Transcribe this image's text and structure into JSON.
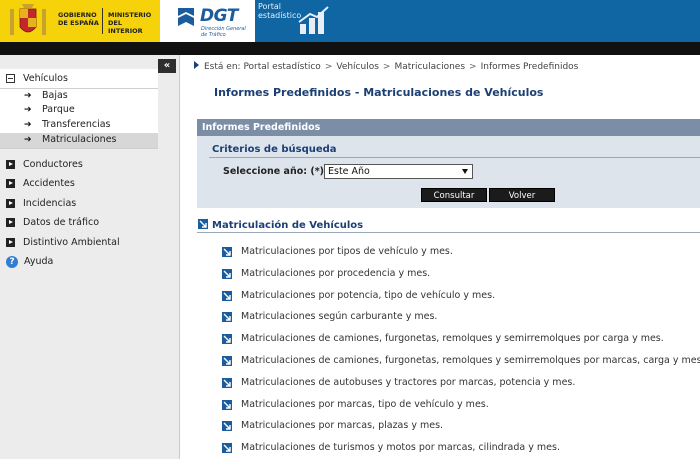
{
  "header": {
    "gov_line1": "GOBIERNO DE ESPAÑA",
    "gov_line2": "MINISTERIO DEL INTERIOR",
    "dgt_name": "DGT",
    "dgt_sub": "Dirección General de Tráfico",
    "portal_label": "Portal estadístico",
    "colors": {
      "gov": "#f5d20a",
      "bar": "#0f66a3",
      "strip": "#111111"
    }
  },
  "sidebar": {
    "collapse_symbol": "«",
    "groups": [
      {
        "label": "Vehículos",
        "open": true
      },
      {
        "label": "Conductores"
      },
      {
        "label": "Accidentes"
      },
      {
        "label": "Incidencias"
      },
      {
        "label": "Datos de tráfico"
      },
      {
        "label": "Distintivo Ambiental"
      }
    ],
    "vehiculos_items": [
      {
        "label": "Bajas"
      },
      {
        "label": "Parque"
      },
      {
        "label": "Transferencias"
      },
      {
        "label": "Matriculaciones",
        "active": true
      }
    ],
    "help_label": "Ayuda"
  },
  "breadcrumb": {
    "prefix": "Está en:",
    "items": [
      "Portal estadístico",
      "Vehículos",
      "Matriculaciones",
      "Informes Predefinidos"
    ],
    "separator": ">"
  },
  "page_title": "Informes Predefinidos - Matriculaciones de Vehículos",
  "panel": {
    "header": "Informes Predefinidos",
    "criteria_title": "Criterios de búsqueda",
    "year_label": "Seleccione año: (*)",
    "year_value": "Este Año",
    "consultar_label": "Consultar",
    "volver_label": "Volver"
  },
  "section_title": "Matriculación de Vehículos",
  "reports": [
    "Matriculaciones por tipos de vehículo y mes.",
    "Matriculaciones por procedencia y mes.",
    "Matriculaciones por potencia, tipo de vehículo y mes.",
    "Matriculaciones según carburante y mes.",
    "Matriculaciones de camiones, furgonetas, remolques y semirremolques por carga y mes.",
    "Matriculaciones de camiones, furgonetas, remolques y semirremolques por marcas, carga y mes.",
    "Matriculaciones de autobuses y tractores por marcas, potencia y mes.",
    "Matriculaciones por marcas, tipo de vehículo y mes.",
    "Matriculaciones por marcas, plazas y mes.",
    "Matriculaciones de turismos y motos por marcas, cilindrada y mes."
  ]
}
